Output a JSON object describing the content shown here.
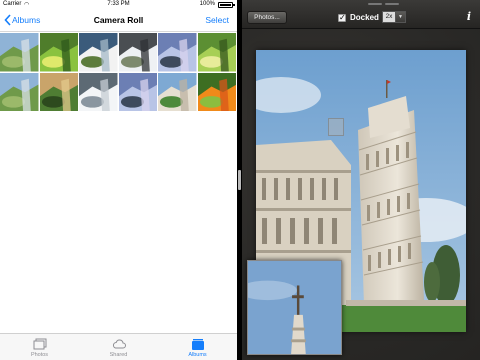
{
  "status": {
    "carrier": "Carrier",
    "time": "7:33 PM",
    "battery": "100%",
    "battery_level": 1.0
  },
  "nav": {
    "back_label": "Albums",
    "title": "Camera Roll",
    "select_label": "Select"
  },
  "thumbnails": [
    "meadow",
    "flowers",
    "waterfall",
    "waterfall-rocks",
    "mountain-lake",
    "flowers-green",
    "meadow",
    "hill-sunset",
    "waterfall-white",
    "mountain-lake",
    "leaning-tower",
    "orange-flower"
  ],
  "tabs": [
    {
      "label": "Photos",
      "icon": "photos-icon",
      "active": false
    },
    {
      "label": "Shared",
      "icon": "cloud-icon",
      "active": false
    },
    {
      "label": "Albums",
      "icon": "albums-icon",
      "active": true
    }
  ],
  "viewer": {
    "photos_button": "Photos...",
    "docked_label": "Docked",
    "docked_checked": true,
    "zoom_value": "2x",
    "info_label": "i"
  },
  "colors": {
    "ios_blue": "#157efb",
    "viewer_bg": "#2b2a28"
  }
}
